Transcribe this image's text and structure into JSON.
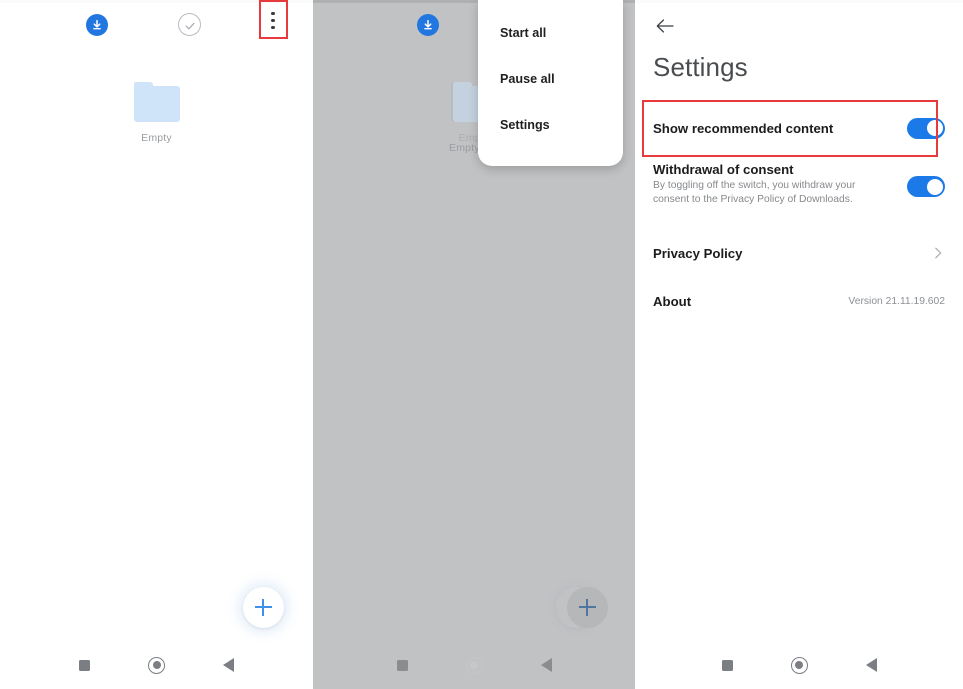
{
  "app": {
    "name": "Downloads",
    "version_label": "Version 21.11.19.602"
  },
  "colors": {
    "accent_blue": "#1b7ae8",
    "fab_plus": "#3e90e8",
    "download_badge": "#2176e0",
    "highlight_red": "#e8393c",
    "scrim_grey": "#b0b1b2",
    "folder_blue": "#cfe4f9",
    "nav_icon_grey": "#7b7e83"
  },
  "panel1": {
    "name": "downloads-list-screen",
    "topbar": {
      "download_icon": "download-circle-icon",
      "select_icon": "check-circle-icon",
      "overflow_icon": "more-vertical-icon"
    },
    "empty_state": {
      "icon": "folder-icon",
      "label": "Empty"
    },
    "fab": {
      "icon": "plus-icon",
      "label": "+"
    },
    "navbar": {
      "recents": "square-icon",
      "home": "circle-icon",
      "back": "triangle-back-icon"
    },
    "highlight": "overflow-menu-button"
  },
  "panel2": {
    "name": "downloads-list-screen-with-menu",
    "topbar": {
      "download_icon": "download-circle-icon"
    },
    "empty_state": {
      "icon": "folder-icon",
      "label": "Empty"
    },
    "menu": {
      "name": "overflow-menu",
      "items": [
        {
          "label": "Start all",
          "highlighted": false
        },
        {
          "label": "Pause all",
          "highlighted": false
        },
        {
          "label": "Settings",
          "highlighted": true
        }
      ]
    },
    "fab": {
      "icon": "plus-icon",
      "label": "+"
    },
    "navbar": {
      "recents": "square-icon",
      "home": "circle-icon",
      "back": "triangle-back-icon"
    },
    "highlight": "menu-item-settings"
  },
  "panel3": {
    "name": "settings-screen",
    "back_icon": "arrow-left-icon",
    "title": "Settings",
    "rows": {
      "recommended": {
        "title": "Show recommended content",
        "toggle_state": "on",
        "highlighted": true
      },
      "withdrawal": {
        "title": "Withdrawal of consent",
        "subtitle": "By toggling off the switch, you withdraw your consent to the Privacy Policy of Downloads.",
        "toggle_state": "on"
      },
      "privacy": {
        "title": "Privacy Policy",
        "chevron": "chevron-right-icon"
      },
      "about": {
        "title": "About",
        "value": "Version 21.11.19.602"
      }
    },
    "navbar": {
      "recents": "square-icon",
      "home": "circle-icon",
      "back": "triangle-back-icon"
    },
    "highlight": "row-show-recommended-content"
  }
}
